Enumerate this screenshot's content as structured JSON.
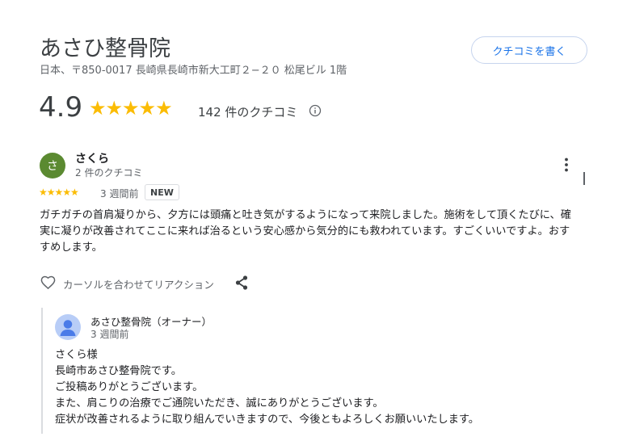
{
  "place": {
    "name": "あさひ整骨院",
    "address": "日本、〒850-0017 長崎県長崎市新大工町２−２０ 松尾ビル 1階",
    "write_review_label": "クチコミを書く",
    "rating": "4.9",
    "stars": "★★★★★",
    "rating_value": 4.9,
    "review_count_label": "142 件のクチコミ"
  },
  "review": {
    "avatar_letter": "さ",
    "avatar_color": "#5b8a31",
    "reviewer_name": "さくら",
    "reviewer_meta": "2 件のクチコミ",
    "stars": "★★★★★",
    "rating_value": 5,
    "date": "3 週間前",
    "badge": "NEW",
    "text": "ガチガチの首肩凝りから、夕方には頭痛と吐き気がするようになって来院しました。施術をして頂くたびに、確実に凝りが改善されてここに来れば治るという安心感から気分的にも救われています。すごくいいですよ。おすすめします。",
    "react_label": "カーソルを合わせてリアクション"
  },
  "owner_response": {
    "name": "あさひ整骨院（オーナー）",
    "date": "3 週間前",
    "lines": [
      "さくら様",
      "長崎市あさひ整骨院です。",
      "ご投稿ありがとうございます。",
      "また、肩こりの治療でご通院いただき、誠にありがとうございます。",
      "症状が改善されるように取り組んでいきますので、今後ともよろしくお願いいたします。"
    ]
  },
  "icons": {
    "info": "info-icon",
    "more": "more-vert-icon",
    "heart": "heart-outline-icon",
    "share": "share-icon",
    "owner_avatar": "person-avatar-icon"
  },
  "colors": {
    "star": "#fbbc04",
    "link_blue": "#1a73e8",
    "owner_avatar_bg": "#b8cdf7",
    "owner_avatar_fg": "#4a7be8"
  }
}
